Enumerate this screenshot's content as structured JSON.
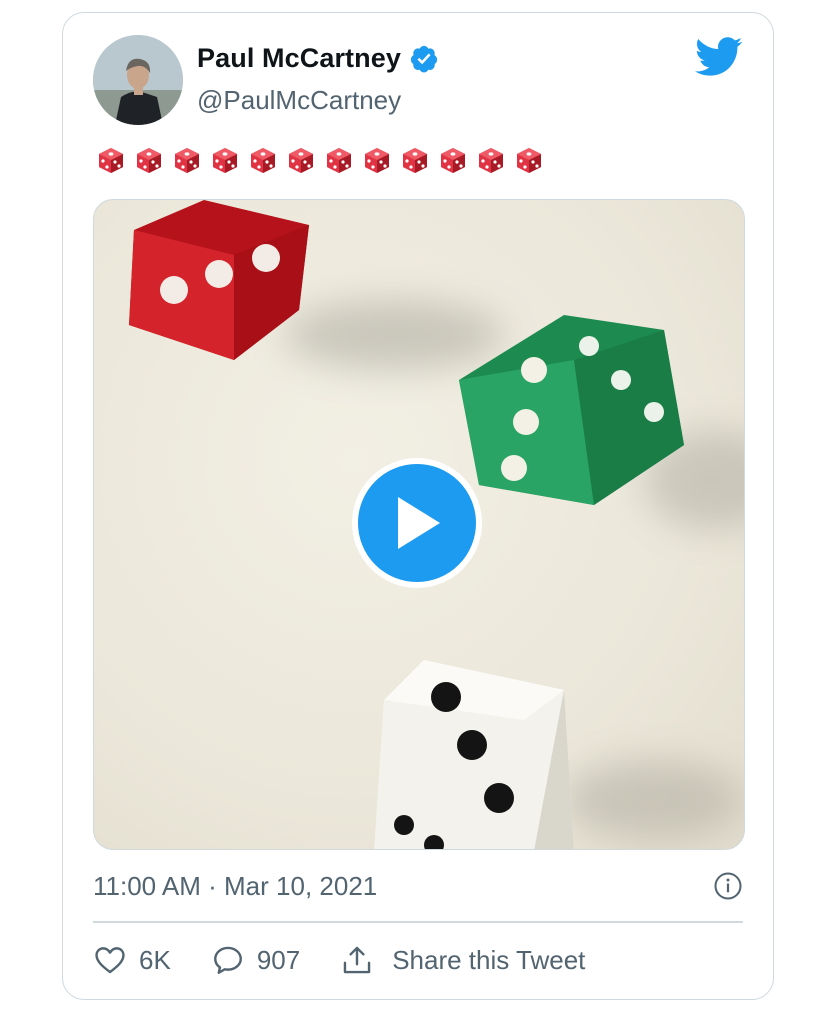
{
  "tweet": {
    "author": {
      "display_name": "Paul McCartney",
      "handle": "@PaulMcCartney",
      "verified": true
    },
    "text_emoji": [
      "game-die",
      "game-die",
      "game-die",
      "game-die",
      "game-die",
      "game-die",
      "game-die",
      "game-die",
      "game-die",
      "game-die",
      "game-die",
      "game-die"
    ],
    "media": {
      "type": "video",
      "play_icon": "play-icon"
    },
    "timestamp": "11:00 AM · Mar 10, 2021",
    "actions": {
      "likes": "6K",
      "replies": "907",
      "share_label": "Share this Tweet"
    }
  },
  "colors": {
    "accent": "#1d9bf0",
    "text_primary": "#0f1419",
    "text_secondary": "#536471",
    "border": "#cfd9de"
  },
  "icons": {
    "verified": "verified-badge-icon",
    "brand": "twitter-bird-icon",
    "info": "info-icon",
    "like": "heart-icon",
    "reply": "reply-bubble-icon",
    "share": "share-icon"
  }
}
